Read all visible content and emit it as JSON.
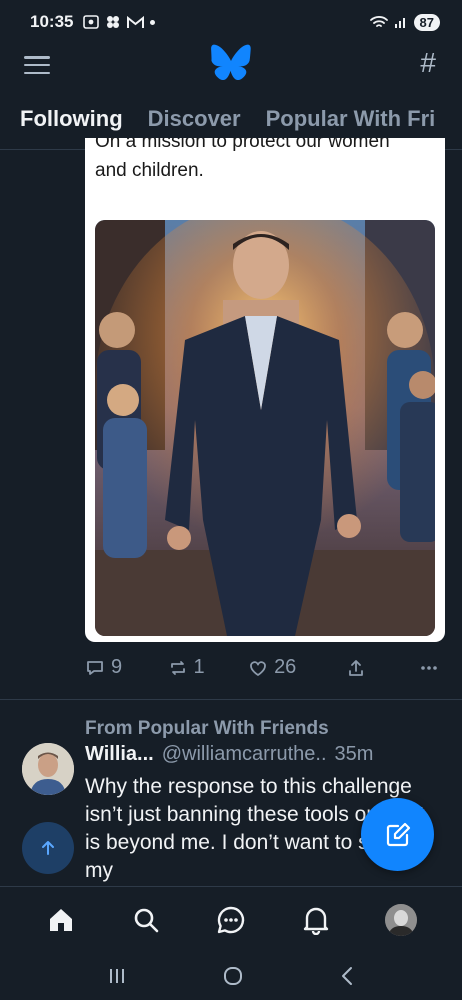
{
  "status_bar": {
    "time": "10:35",
    "battery": "87"
  },
  "header": {
    "logo": "butterfly-logo",
    "menu_icon": "hamburger-icon",
    "feeds_icon": "hash-icon"
  },
  "tabs": [
    {
      "label": "Following",
      "active": true
    },
    {
      "label": "Discover",
      "active": false
    },
    {
      "label": "Popular With Fri",
      "active": false
    }
  ],
  "post1": {
    "quote_text_top": "On a mission to protect our women",
    "quote_text_line2": "and children.",
    "image_alt_icon": "ai-image-man-in-suit",
    "replies": "9",
    "reposts": "1",
    "likes": "26"
  },
  "post2": {
    "repost_label": "From Popular With Friends",
    "author_name": "Willia...",
    "author_handle": "@williamcarruthe..",
    "time": "35m",
    "text": "Why the response to this challenge isn’t just banning these tools outright is beyond me. I don’t want to spend my"
  },
  "colors": {
    "background": "#161e27",
    "accent": "#1185fe",
    "muted": "#8c9aab"
  },
  "bottom_nav": [
    "home-icon",
    "search-icon",
    "chat-icon",
    "bell-icon",
    "profile-avatar"
  ]
}
